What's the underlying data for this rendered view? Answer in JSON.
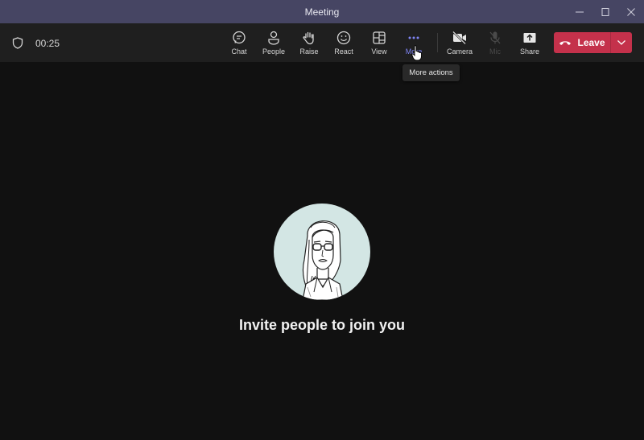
{
  "window": {
    "title": "Meeting",
    "controls": [
      {
        "name": "minimize",
        "icon": "minimize-icon"
      },
      {
        "name": "maximize",
        "icon": "maximize-icon"
      },
      {
        "name": "close",
        "icon": "close-icon"
      }
    ]
  },
  "toolbar": {
    "security_icon": "shield-icon",
    "timer": "00:25",
    "buttons": [
      {
        "id": "chat",
        "label": "Chat",
        "icon": "chat-icon"
      },
      {
        "id": "people",
        "label": "People",
        "icon": "people-icon"
      },
      {
        "id": "raise",
        "label": "Raise",
        "icon": "raise-hand-icon"
      },
      {
        "id": "react",
        "label": "React",
        "icon": "smiley-icon"
      },
      {
        "id": "view",
        "label": "View",
        "icon": "view-layout-icon"
      },
      {
        "id": "more",
        "label": "More",
        "icon": "more-dots-icon",
        "state": "hovered"
      },
      {
        "id": "camera",
        "label": "Camera",
        "icon": "camera-off-icon"
      },
      {
        "id": "mic",
        "label": "Mic",
        "icon": "mic-off-icon",
        "state": "disabled"
      },
      {
        "id": "share",
        "label": "Share",
        "icon": "share-tray-icon"
      }
    ],
    "leave": {
      "label": "Leave",
      "icon": "hang-up-icon",
      "dropdown_icon": "chevron-down-icon",
      "color": "#c4314b"
    }
  },
  "tooltip": {
    "text": "More actions"
  },
  "stage": {
    "avatar_alt": "Illustrated avatar of a woman with glasses",
    "message": "Invite people to join you"
  },
  "colors": {
    "titlebar": "#464563",
    "toolbar": "#1f1f1f",
    "stage": "#111111",
    "accent": "#7f85f5",
    "leave": "#c4314b"
  }
}
